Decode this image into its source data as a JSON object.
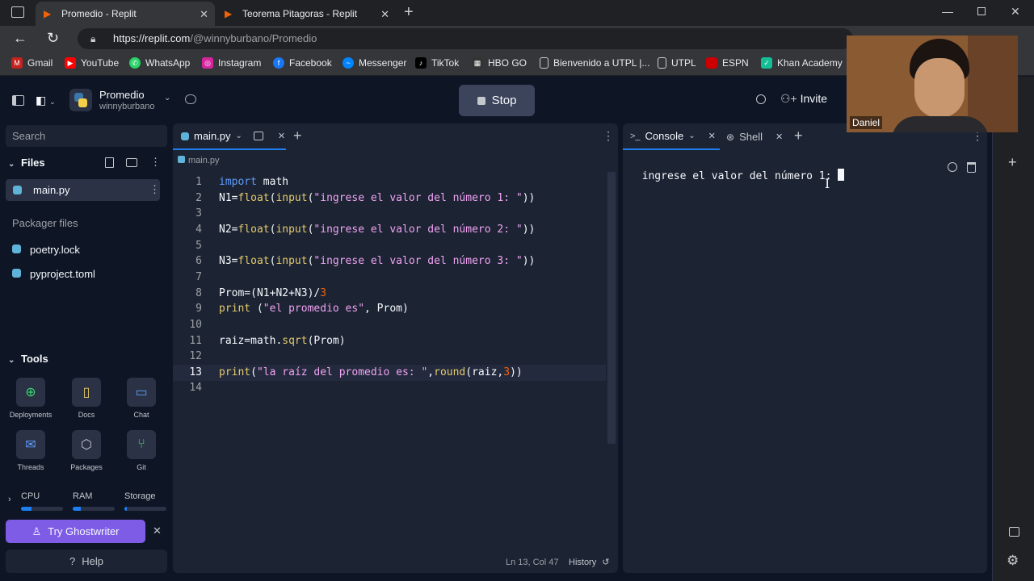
{
  "browser": {
    "tabs": [
      {
        "title": "Promedio - Replit",
        "active": true
      },
      {
        "title": "Teorema Pitagoras - Replit",
        "active": false
      }
    ],
    "url_host": "https://replit.com",
    "url_path": "/@winnyburbano/Promedio",
    "bookmarks": [
      "Gmail",
      "YouTube",
      "WhatsApp",
      "Instagram",
      "Facebook",
      "Messenger",
      "TikTok",
      "HBO GO",
      "Bienvenido a UTPL |...",
      "UTPL",
      "ESPN",
      "Khan Academy"
    ]
  },
  "webcam": {
    "name": "Daniel"
  },
  "header": {
    "project_name": "Promedio",
    "owner": "winnyburbano",
    "stop_label": "Stop",
    "invite_label": "Invite"
  },
  "sidebar": {
    "search_placeholder": "Search",
    "files_label": "Files",
    "files": [
      "main.py"
    ],
    "packager_label": "Packager files",
    "packager_files": [
      "poetry.lock",
      "pyproject.toml"
    ],
    "tools_label": "Tools",
    "tools": [
      {
        "label": "Deployments",
        "icon": "deployments-icon"
      },
      {
        "label": "Docs",
        "icon": "docs-icon"
      },
      {
        "label": "Chat",
        "icon": "chat-icon"
      },
      {
        "label": "Threads",
        "icon": "threads-icon"
      },
      {
        "label": "Packages",
        "icon": "packages-icon"
      },
      {
        "label": "Git",
        "icon": "git-icon"
      }
    ],
    "resources": [
      {
        "label": "CPU",
        "fill": 0.25
      },
      {
        "label": "RAM",
        "fill": 0.2
      },
      {
        "label": "Storage",
        "fill": 0.05
      }
    ],
    "ghostwriter_label": "Try Ghostwriter",
    "help_label": "Help"
  },
  "editor": {
    "tab_label": "main.py",
    "breadcrumb": "main.py",
    "status_position": "Ln 13, Col 47",
    "history_label": "History",
    "lines": [
      "import math",
      "N1=float(input(\"ingrese el valor del número 1: \"))",
      "",
      "N2=float(input(\"ingrese el valor del número 2: \"))",
      "",
      "N3=float(input(\"ingrese el valor del número 3: \"))",
      "",
      "Prom=(N1+N2+N3)/3",
      "print (\"el promedio es\", Prom)",
      "",
      "raiz=math.sqrt(Prom)",
      "",
      "print(\"la raíz del promedio es: \",round(raiz,3))",
      ""
    ],
    "current_line": 13
  },
  "console": {
    "tab_console": "Console",
    "tab_shell": "Shell",
    "output": "ingrese el valor del número 1: "
  }
}
